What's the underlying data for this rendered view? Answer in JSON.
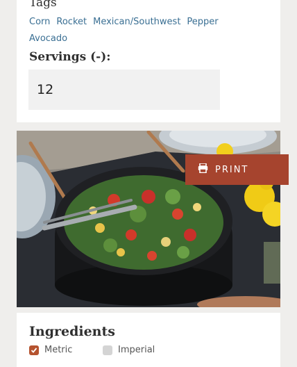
{
  "tags_section": {
    "heading": "Tags",
    "items": [
      "Corn",
      "Rocket",
      "Mexican/Southwest",
      "Pepper",
      "Avocado"
    ]
  },
  "servings": {
    "label": "Servings (-):",
    "value": "12"
  },
  "print_button": {
    "label": "PRINT",
    "icon": "printer-icon",
    "color": "#a6442e"
  },
  "ingredients": {
    "heading": "Ingredients",
    "units": [
      {
        "label": "Metric",
        "checked": true
      },
      {
        "label": "Imperial",
        "checked": false
      }
    ],
    "accent_color": "#b5532f"
  }
}
